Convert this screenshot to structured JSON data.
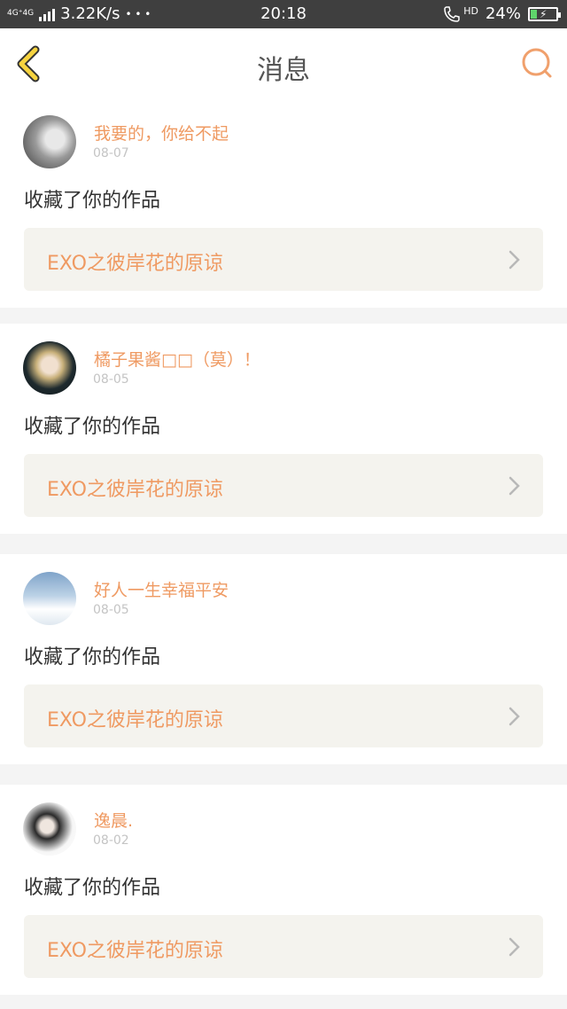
{
  "status_bar": {
    "network": "4G⁺4G",
    "speed": "3.22K/s",
    "dots": "• • •",
    "time": "20:18",
    "hd": "HD",
    "battery_percent": "24%",
    "battery_level": 0.24
  },
  "header": {
    "title": "消息"
  },
  "colors": {
    "accent": "#ef9a62",
    "card_item_bg": "#f4f3ee",
    "status_bar_bg": "#3f3f3f"
  },
  "messages": [
    {
      "user": "我要的，你给不起",
      "date": "08-07",
      "action": "收藏了你的作品",
      "work": "EXO之彼岸花的原谅"
    },
    {
      "user": "橘子果酱□□（莫）！",
      "date": "08-05",
      "action": "收藏了你的作品",
      "work": "EXO之彼岸花的原谅"
    },
    {
      "user": "好人一生幸福平安",
      "date": "08-05",
      "action": "收藏了你的作品",
      "work": "EXO之彼岸花的原谅"
    },
    {
      "user": "逸晨.",
      "date": "08-02",
      "action": "收藏了你的作品",
      "work": "EXO之彼岸花的原谅"
    }
  ]
}
